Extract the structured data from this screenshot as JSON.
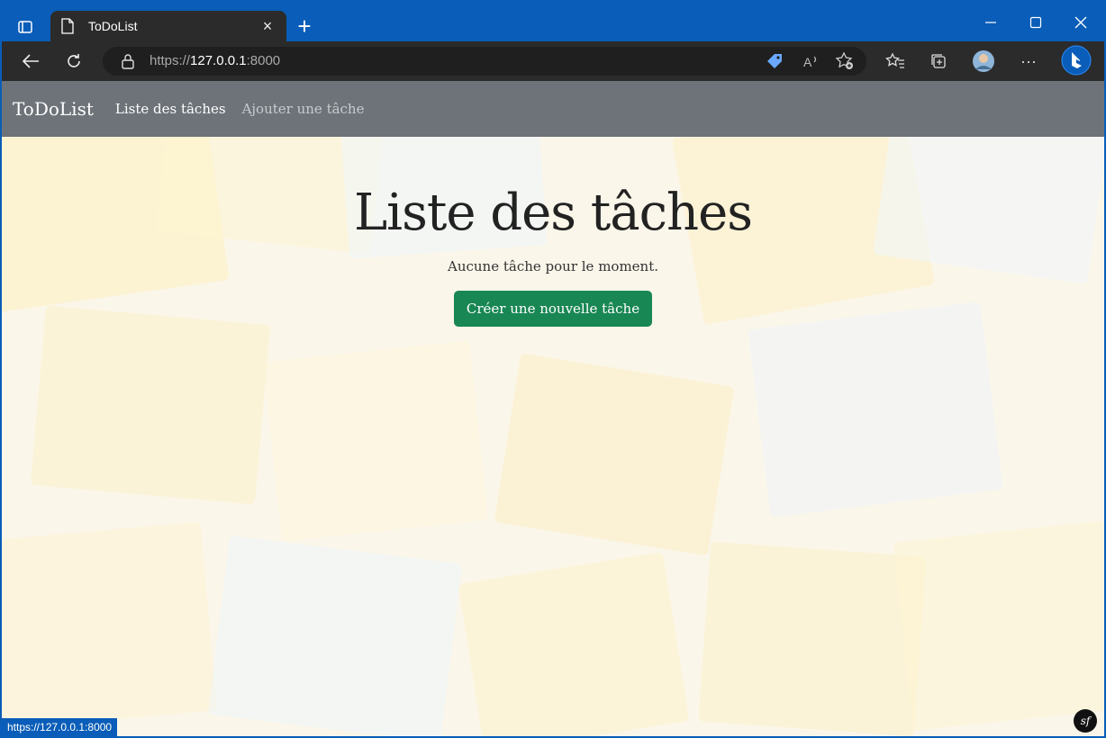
{
  "browser": {
    "tab_title": "ToDoList",
    "url_scheme": "https://",
    "url_host": "127.0.0.1",
    "url_port": ":8000",
    "status_url": "https://127.0.0.1:8000",
    "icons": [
      "tab-actions-icon",
      "document-icon",
      "close-icon",
      "plus-icon",
      "minimize-icon",
      "maximize-icon",
      "window-close-icon",
      "back-arrow-icon",
      "refresh-icon",
      "lock-icon",
      "price-tag-icon",
      "read-aloud-icon",
      "add-favorite-icon",
      "favorites-icon",
      "collections-icon",
      "profile-avatar-icon",
      "more-icon",
      "bing-icon"
    ]
  },
  "navbar": {
    "brand": "ToDoList",
    "links": [
      {
        "label": "Liste des tâches",
        "active": true
      },
      {
        "label": "Ajouter une tâche",
        "active": false
      }
    ],
    "bg_color": "#6d7379"
  },
  "main": {
    "title": "Liste des tâches",
    "empty_message": "Aucune tâche pour le moment.",
    "create_button": "Créer une nouvelle tâche",
    "button_color": "#198754"
  },
  "footer": {
    "symfony_badge": "sf"
  }
}
